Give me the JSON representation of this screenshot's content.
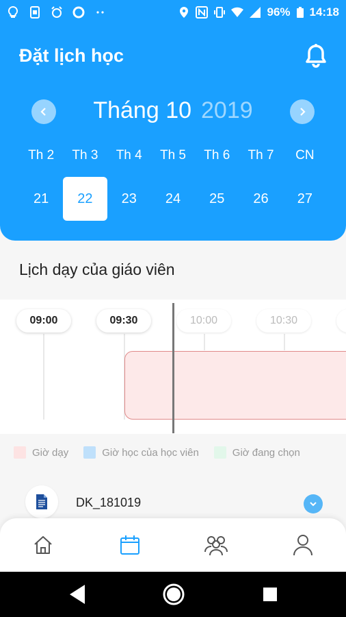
{
  "status_bar": {
    "battery": "96%",
    "time": "14:18",
    "icons_left": [
      "bulb-icon",
      "sim-icon",
      "alarm-icon",
      "circle-icon",
      "more-dots-icon"
    ],
    "icons_right": [
      "location-icon",
      "nfc-icon",
      "vibrate-icon",
      "wifi-icon",
      "signal-icon",
      "battery-icon"
    ]
  },
  "header": {
    "title": "Đặt lịch học",
    "month": "Tháng 10",
    "year": "2019",
    "weekdays": [
      "Th 2",
      "Th 3",
      "Th 4",
      "Th 5",
      "Th 6",
      "Th 7",
      "CN"
    ],
    "days": [
      "21",
      "22",
      "23",
      "24",
      "25",
      "26",
      "27"
    ],
    "selected_day": "22"
  },
  "schedule": {
    "title": "Lịch dạy của giáo viên",
    "times": [
      "09:00",
      "09:30",
      "10:00",
      "10:30"
    ]
  },
  "legend": [
    {
      "label": "Giờ dạy",
      "color": "#fde3e3"
    },
    {
      "label": "Giờ học của học viên",
      "color": "#bfe0fb"
    },
    {
      "label": "Giờ đang chọn",
      "color": "#e2f7ea"
    }
  ],
  "document": {
    "name": "DK_181019"
  },
  "bottom_nav": [
    "home-icon",
    "calendar-icon",
    "group-icon",
    "profile-icon"
  ],
  "colors": {
    "primary": "#1aa0ff",
    "busy_fill": "#fde9e9",
    "busy_border": "#e08a8a"
  }
}
